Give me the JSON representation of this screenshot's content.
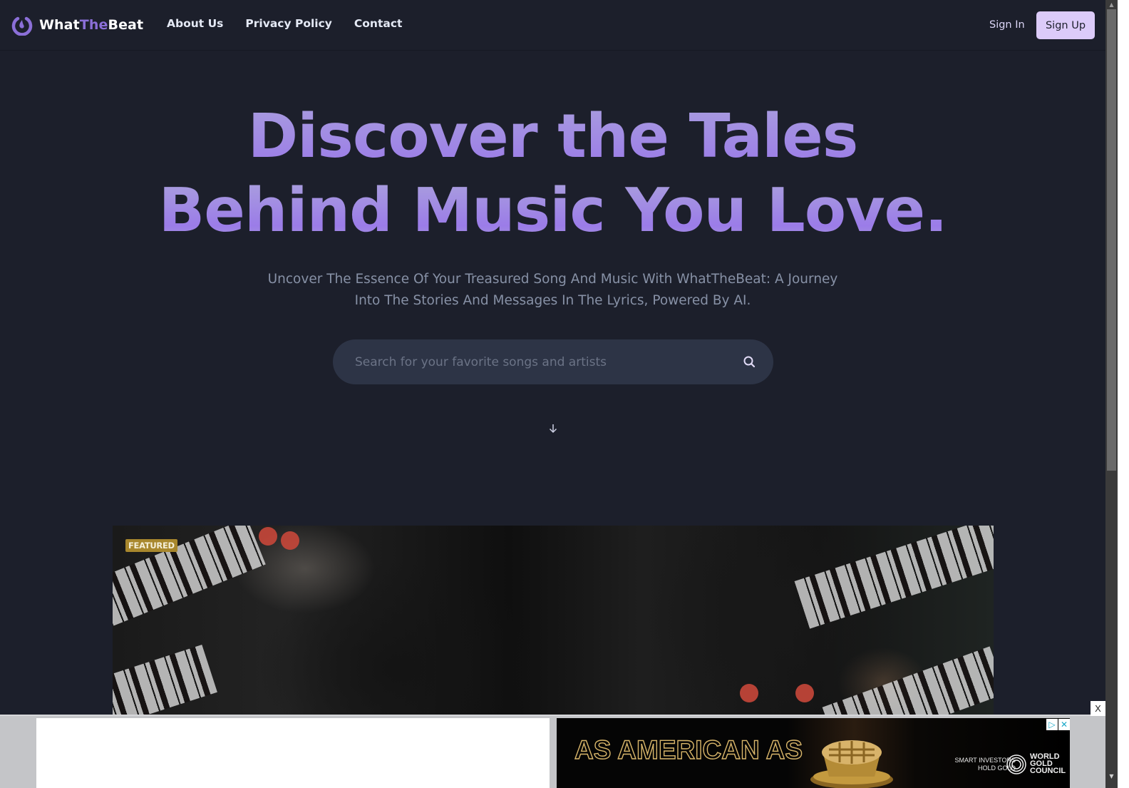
{
  "brand": {
    "name_part1": "What",
    "name_part2": "The",
    "name_part3": "Beat",
    "accent_color": "#8b6fd8"
  },
  "nav": {
    "links": [
      {
        "label": "About Us"
      },
      {
        "label": "Privacy Policy"
      },
      {
        "label": "Contact"
      }
    ],
    "sign_in": "Sign In",
    "sign_up": "Sign Up"
  },
  "hero": {
    "headline_line1": "Discover the Tales",
    "headline_line2": "Behind Music You Love.",
    "subtitle": "Uncover The Essence Of Your Treasured Song And Music With WhatTheBeat: A Journey Into The Stories And Messages In The Lyrics, Powered By AI.",
    "search": {
      "placeholder": "Search for your favorite songs and artists",
      "value": "",
      "icon": "search-icon"
    },
    "scroll_icon": "arrow-down-icon"
  },
  "featured": {
    "badge": "FEATURED"
  },
  "ad": {
    "headline": "AS AMERICAN AS",
    "tagline_line1": "SMART INVESTORS",
    "tagline_line2": "HOLD GOLD",
    "brand_line1": "WORLD",
    "brand_line2": "GOLD",
    "brand_line3": "COUNCIL",
    "adchoices_icon": "▷",
    "ad_close_icon": "✕",
    "close_label": "X"
  },
  "scrollbar": {
    "up": "▲",
    "down": "▼"
  }
}
